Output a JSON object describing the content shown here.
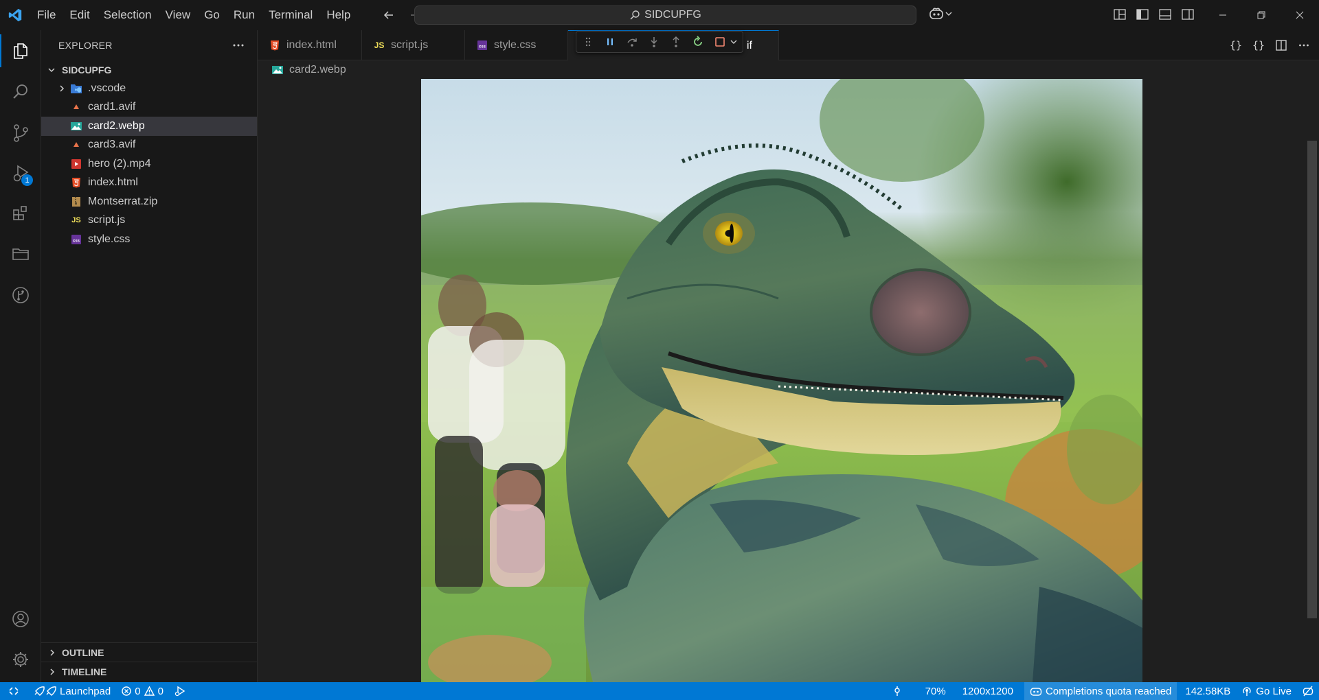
{
  "menu": [
    "File",
    "Edit",
    "Selection",
    "View",
    "Go",
    "Run",
    "Terminal",
    "Help"
  ],
  "command_center": {
    "label": "SIDCUPFG"
  },
  "explorer": {
    "title": "EXPLORER",
    "folder": "SIDCUPFG",
    "items": [
      {
        "name": ".vscode",
        "icon": "vscode-folder-icon",
        "folder": true
      },
      {
        "name": "card1.avif",
        "icon": "avif-file-icon"
      },
      {
        "name": "card2.webp",
        "icon": "image-file-icon",
        "selected": true
      },
      {
        "name": "card3.avif",
        "icon": "avif-file-icon"
      },
      {
        "name": "hero (2).mp4",
        "icon": "video-file-icon"
      },
      {
        "name": "index.html",
        "icon": "html-file-icon"
      },
      {
        "name": "Montserrat.zip",
        "icon": "zip-file-icon"
      },
      {
        "name": "script.js",
        "icon": "js-file-icon"
      },
      {
        "name": "style.css",
        "icon": "css-file-icon"
      }
    ],
    "outline": "OUTLINE",
    "timeline": "TIMELINE"
  },
  "activity_badge": "1",
  "tabs": [
    {
      "label": "index.html",
      "icon": "html-file-icon"
    },
    {
      "label": "script.js",
      "icon": "js-file-icon"
    },
    {
      "label": "style.css",
      "icon": "css-file-icon"
    },
    {
      "label": "if",
      "icon": "image-file-icon",
      "active": true
    }
  ],
  "breadcrumb": {
    "file": "card2.webp"
  },
  "editor_actions": [
    "{}",
    "{}"
  ],
  "status": {
    "launchpad": "Launchpad",
    "errors": "0",
    "warnings": "0",
    "zoom": "70%",
    "dimensions": "1200x1200",
    "completions": "Completions quota reached",
    "size": "142.58KB",
    "golive": "Go Live"
  },
  "colors": {
    "accent": "#0078d4",
    "statusbar": "#0078d4",
    "html": "#e44d26",
    "js": "#f1e05a",
    "css": "#663399",
    "image": "#26a69a"
  }
}
